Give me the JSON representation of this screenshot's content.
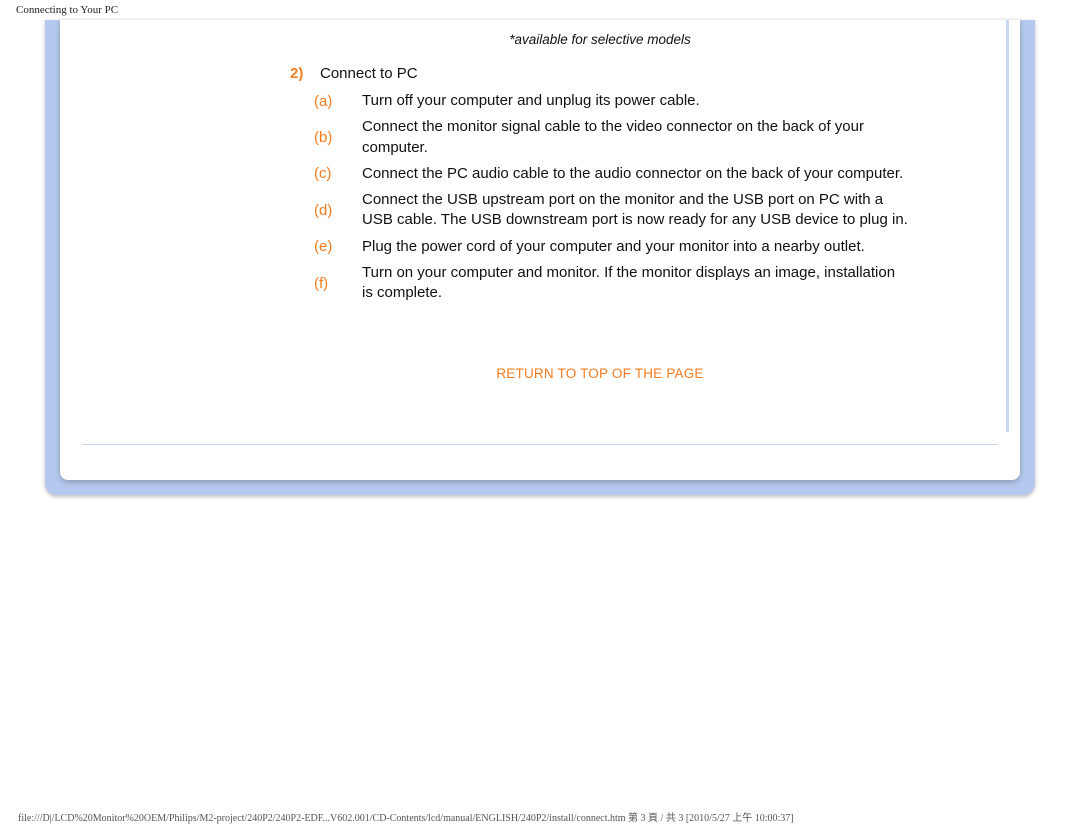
{
  "page_header": "Connecting to Your PC",
  "note": "*available for selective models",
  "section": {
    "number": "2)",
    "title": "Connect to PC"
  },
  "steps": [
    {
      "marker": "(a)",
      "text": "Turn off your computer and unplug its power cable."
    },
    {
      "marker": "(b)",
      "text": "Connect the monitor signal cable to the video connector on the back of your computer."
    },
    {
      "marker": "(c)",
      "text": "Connect the PC audio cable to the audio connector on the back of your computer."
    },
    {
      "marker": "(d)",
      "text": "Connect the USB upstream port on the monitor and the USB port on PC with a USB cable. The USB downstream port is now ready for any USB device to plug in."
    },
    {
      "marker": "(e)",
      "text": "Plug the power cord of your computer and your monitor into a nearby outlet."
    },
    {
      "marker": "(f)",
      "text": "Turn on your computer and monitor. If the monitor displays an image, installation is complete."
    }
  ],
  "return_link": "RETURN TO TOP OF THE PAGE",
  "footer": "file:///D|/LCD%20Monitor%20OEM/Philips/M2-project/240P2/240P2-EDF...V602.001/CD-Contents/lcd/manual/ENGLISH/240P2/install/connect.htm 第 3 頁 / 共 3  [2010/5/27 上午 10:00:37]"
}
